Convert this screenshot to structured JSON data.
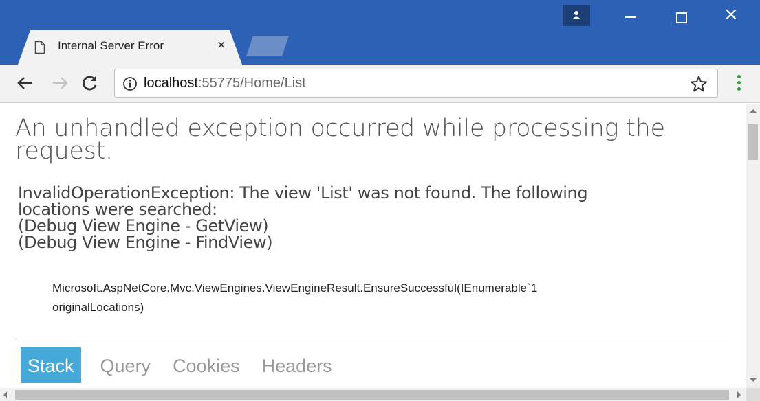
{
  "window": {
    "tab_title": "Internal Server Error",
    "tab_close_label": "×",
    "minimize_icon": "minimize-icon",
    "maximize_icon": "maximize-icon",
    "close_label": "×",
    "profile_icon": "profile-icon"
  },
  "toolbar": {
    "back_icon": "arrow-left-icon",
    "forward_icon": "arrow-right-icon",
    "reload_icon": "reload-icon",
    "info_icon": "info-icon",
    "url_host": "localhost",
    "url_rest": ":55775/Home/List",
    "bookmark_icon": "star-icon",
    "menu_icon": "kebab-menu-icon"
  },
  "page": {
    "headline_line1": "An unhandled exception occurred while processing the",
    "headline_line2": "request.",
    "exception_lines": [
      "InvalidOperationException: The view 'List' was not found. The following",
      "locations were searched:",
      "(Debug View Engine - GetView)",
      "(Debug View Engine - FindView)"
    ],
    "location_line1": "Microsoft.AspNetCore.Mvc.ViewEngines.ViewEngineResult.EnsureSuccessful(IEnumerable`1",
    "location_line2": "originalLocations)",
    "tabs": [
      {
        "label": "Stack",
        "active": true
      },
      {
        "label": "Query",
        "active": false
      },
      {
        "label": "Cookies",
        "active": false
      },
      {
        "label": "Headers",
        "active": false
      }
    ]
  },
  "colors": {
    "titlebar": "#2d61b5",
    "active_tab": "#44a9d8",
    "menu_dots": "#2e9b3c"
  }
}
